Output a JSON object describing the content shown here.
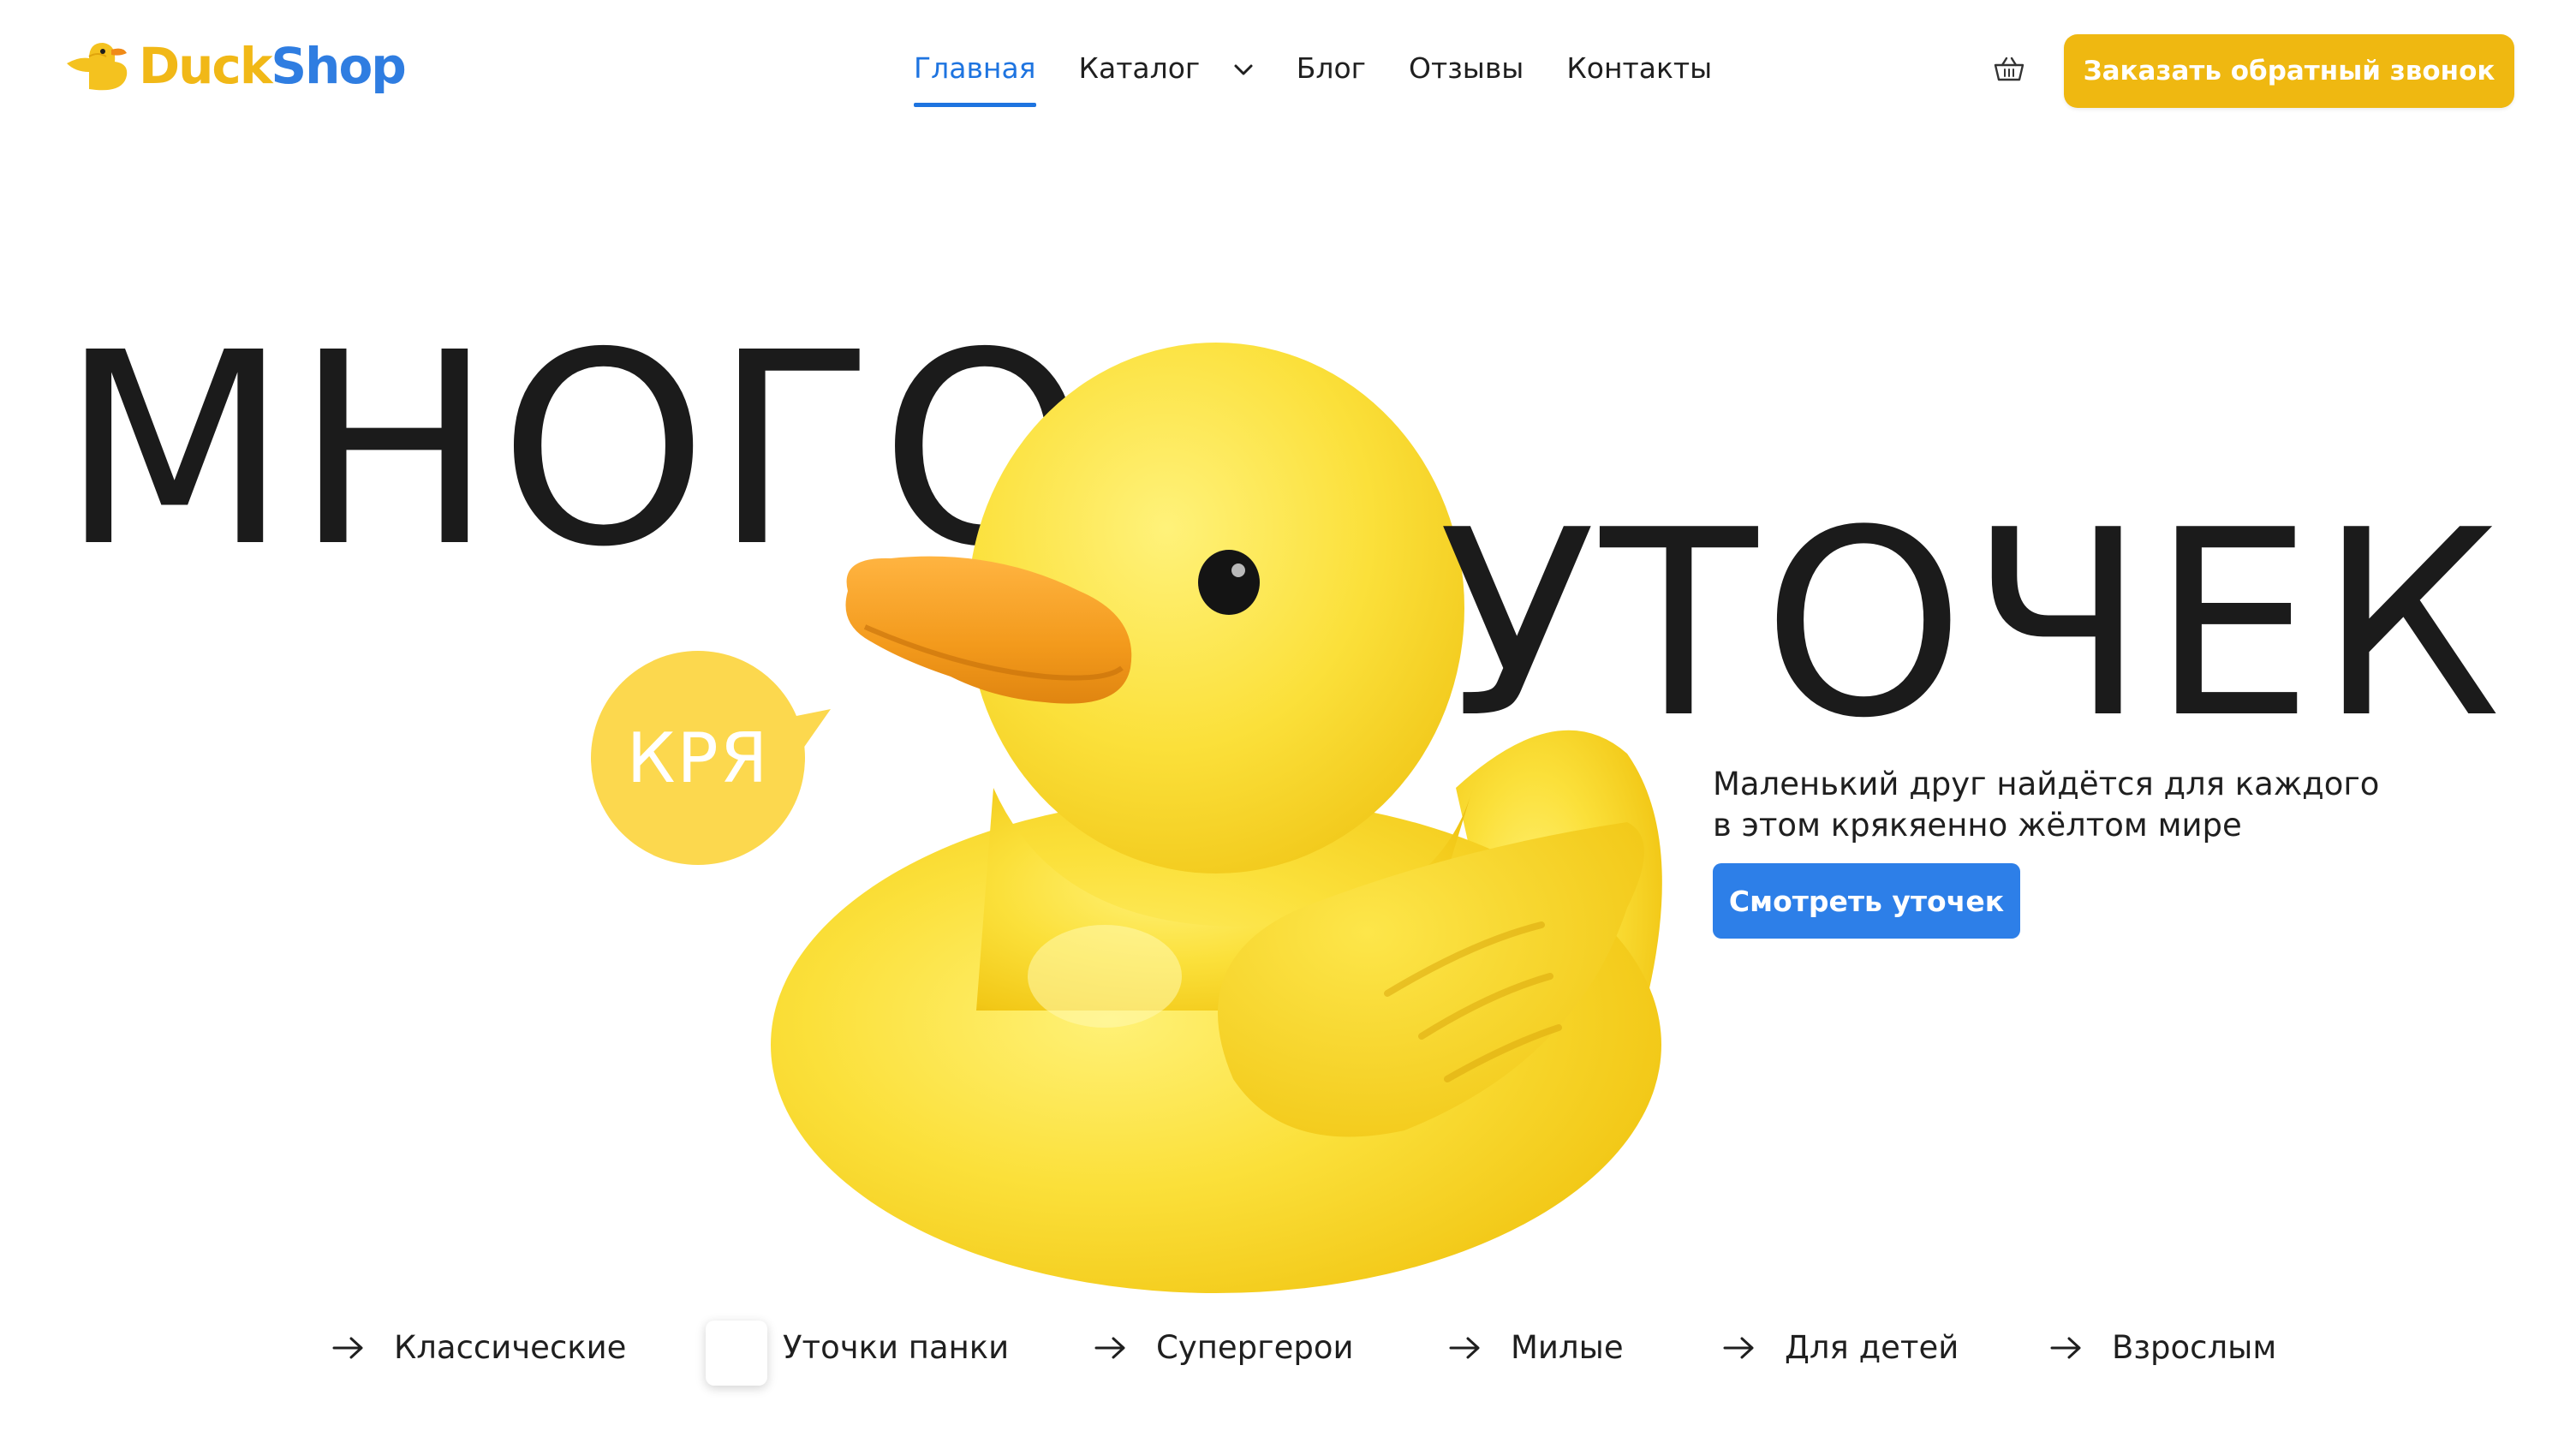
{
  "header": {
    "logo": {
      "part1": "Duck",
      "part2": "Shop"
    },
    "nav": [
      {
        "label": "Главная",
        "active": true
      },
      {
        "label": "Каталог",
        "dropdown": true
      },
      {
        "label": "Блог"
      },
      {
        "label": "Отзывы"
      },
      {
        "label": "Контакты"
      }
    ],
    "cart_icon": "basket-icon",
    "callback_button": "Заказать обратный звонок"
  },
  "hero": {
    "word1": "МНОГО",
    "word2": "УТОЧЕК",
    "bubble": "КРЯ",
    "tagline_line1": "Маленький друг найдётся для каждого",
    "tagline_line2": "в этом крякяенно жёлтом мире",
    "cta": "Смотреть уточек"
  },
  "categories": [
    {
      "label": "Классические"
    },
    {
      "label": "Уточки панки"
    },
    {
      "label": "Супергерои"
    },
    {
      "label": "Милые"
    },
    {
      "label": "Для детей"
    },
    {
      "label": "Взрослым"
    }
  ],
  "colors": {
    "accent_yellow": "#efb811",
    "accent_blue": "#2d7fe8",
    "bubble_yellow": "#fcd84e",
    "text": "#1b1b1b"
  }
}
